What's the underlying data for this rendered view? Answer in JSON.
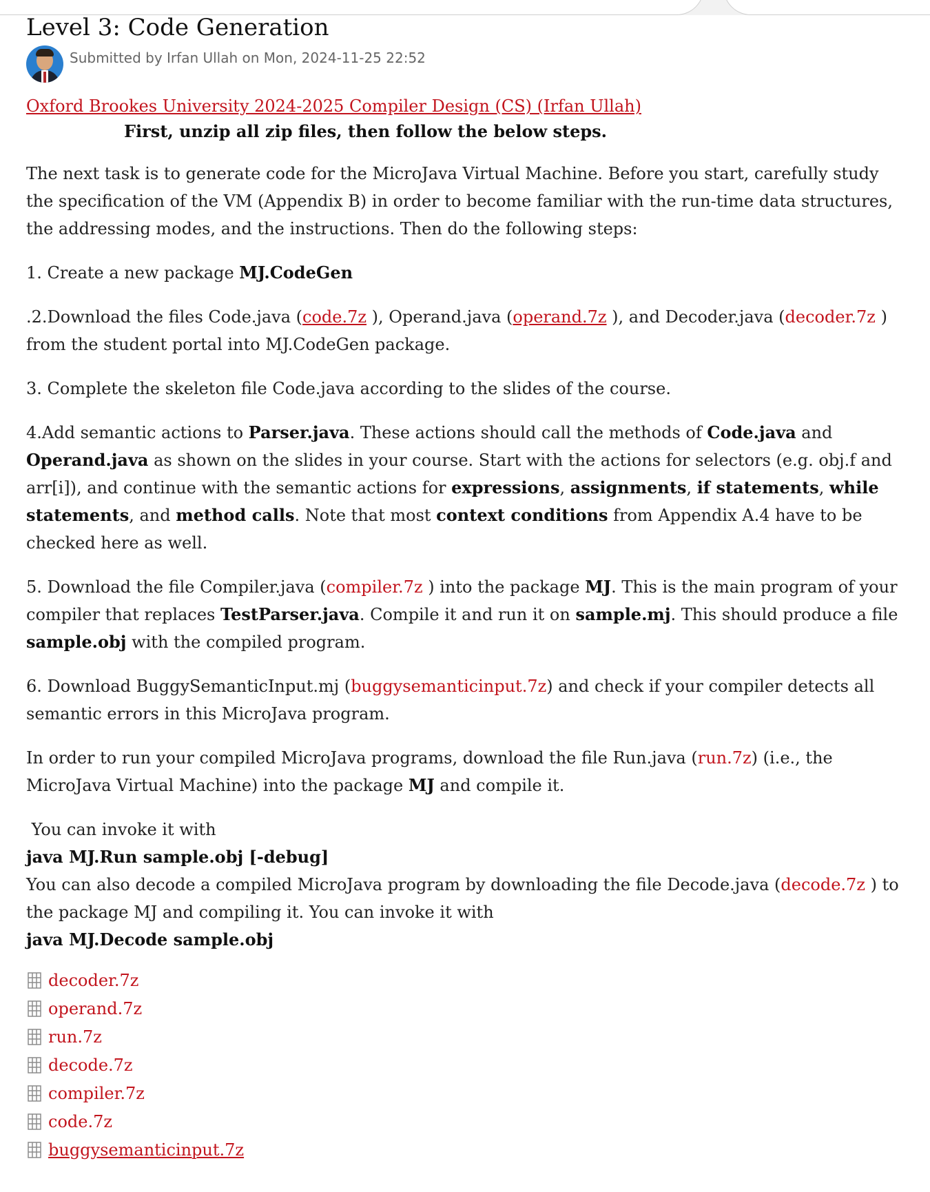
{
  "page": {
    "title": "Level 3: Code Generation",
    "byline": "Submitted by Irfan Ullah on Mon, 2024-11-25 22:52"
  },
  "course_link": "Oxford Brookes University 2024-2025 Compiler Design (CS) (Irfan Ullah)",
  "headline": "First, unzip all zip files, then follow the below steps.",
  "intro": {
    "text": "The next task is to generate code for the MicroJava Virtual Machine. Before you start, carefully study the specification of the VM (Appendix B) in order to become familiar with the run-time data structures, the addressing modes, and the instructions. Then do the following steps:"
  },
  "step1": {
    "prefix": "1. Create a new package ",
    "bold": "MJ.CodeGen"
  },
  "step2": {
    "t1": ".2.Download the files Code.java (",
    "l1": "code.7z",
    "t2": " ), Operand.java (",
    "l2": "operand.7z",
    "t3": " ), and Decoder.java (",
    "l3": "decoder.7z",
    "t4": " ) from the student portal into  MJ.CodeGen package."
  },
  "step3": {
    "text": "3. Complete the skeleton file Code.java according to the slides of the course."
  },
  "step4": {
    "t1": "4.Add semantic actions to ",
    "b1": "Parser.java",
    "t2": ". These actions should call the methods of ",
    "b2": "Code.java",
    "t3": " and ",
    "b3": "Operand.java",
    "t4": " as shown on the slides in your course. Start with the actions for selectors (e.g. obj.f and arr[i]), and continue with the semantic actions for ",
    "b4": "expressions",
    "t5": ", ",
    "b5": "assignments",
    "t6": ", ",
    "b6": "if statements",
    "t7": ", ",
    "b7": "while statements",
    "t8": ", and ",
    "b8": "method calls",
    "t9": ". Note that most ",
    "b9": "context conditions",
    "t10": " from Appendix A.4 have to be checked here as well."
  },
  "step5": {
    "t1": "5. Download the file Compiler.java (",
    "l1": "compiler.7z",
    "t2": " ) into the package ",
    "b1": "MJ",
    "t3": ". This is the main program of your compiler that replaces ",
    "b2": "TestParser.java",
    "t4": ". Compile it and run it on ",
    "b3": "sample.mj",
    "t5": ". This should produce a file ",
    "b4": "sample.obj",
    "t6": " with the compiled program."
  },
  "step6": {
    "t1": "6. Download BuggySemanticInput.mj (",
    "l1": "buggysemanticinput.7z",
    "t2": ") and check if your compiler detects all semantic errors in this MicroJava program."
  },
  "run": {
    "t1": "In order to run your compiled MicroJava programs, download the file Run.java  (",
    "l1": "run.7z",
    "t2": ") (i.e., the MicroJava Virtual Machine) into the package ",
    "b1": "MJ",
    "t3": " and compile it."
  },
  "invoke": {
    "text": " You can invoke it with",
    "command": "java MJ.Run sample.obj [-debug]",
    "t1": "You can also decode a compiled MicroJava program by downloading the file Decode.java (",
    "l1": "decode.7z",
    "t2": " ) to the package MJ and compiling it. You can invoke it with",
    "command2": "java MJ.Decode sample.obj"
  },
  "attachments": [
    {
      "name": "decoder.7z",
      "icon": "archive-file-icon"
    },
    {
      "name": "operand.7z",
      "icon": "archive-file-icon"
    },
    {
      "name": "run.7z",
      "icon": "archive-file-icon"
    },
    {
      "name": "decode.7z",
      "icon": "archive-file-icon"
    },
    {
      "name": "compiler.7z",
      "icon": "archive-file-icon"
    },
    {
      "name": "code.7z",
      "icon": "archive-file-icon"
    },
    {
      "name": "buggysemanticinput.7z",
      "icon": "archive-file-icon"
    }
  ],
  "colors": {
    "link": "#c2141d",
    "text": "#222222",
    "byline": "#666666"
  }
}
